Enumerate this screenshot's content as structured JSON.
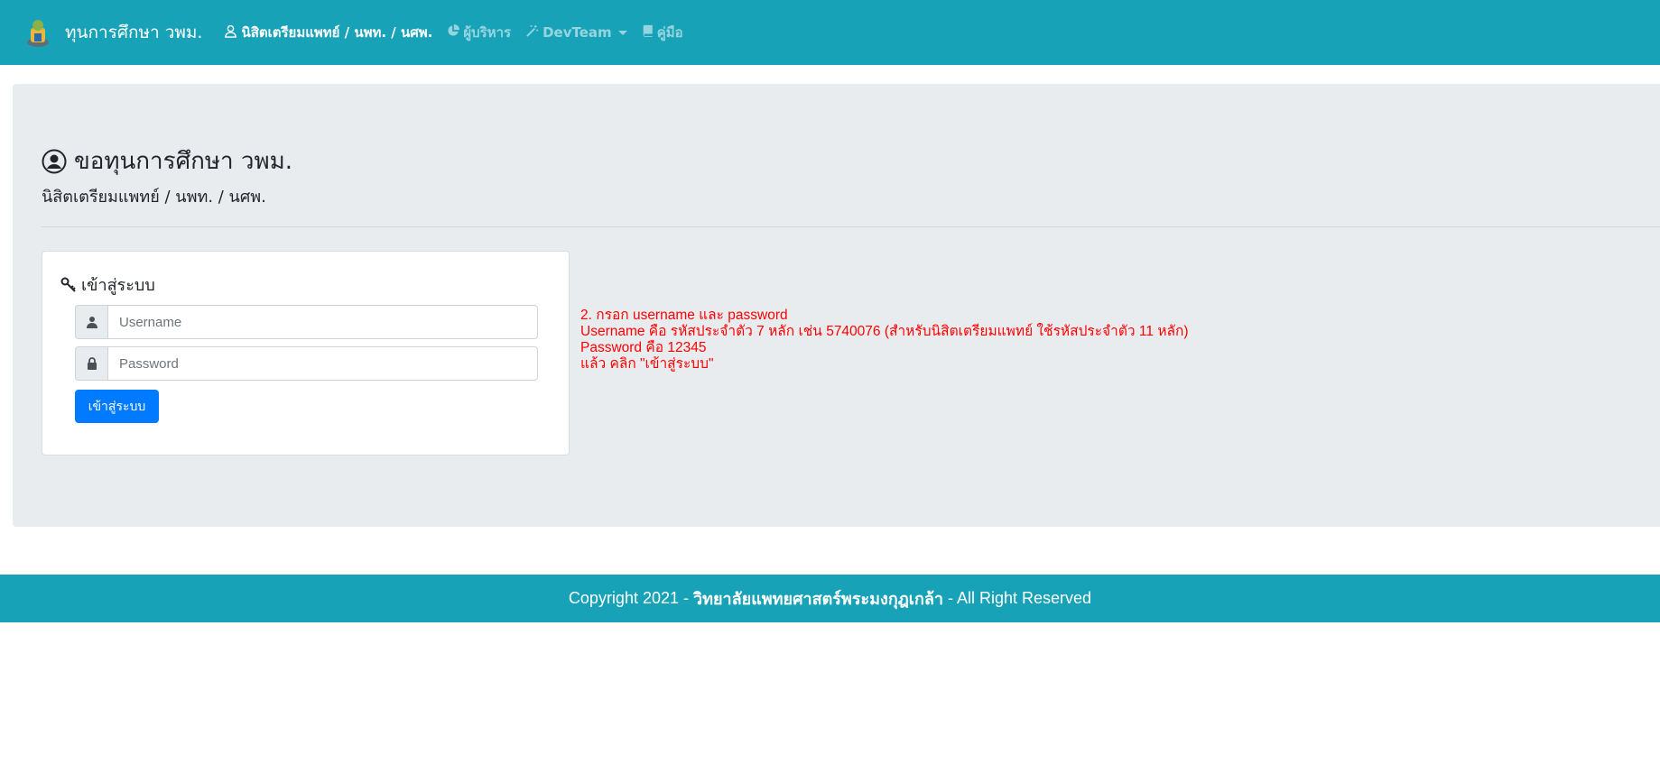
{
  "navbar": {
    "brand_title": "ทุนการศึกษา วพม.",
    "items": [
      {
        "label": "นิสิตเตรียมแพทย์ / นพท. / นศพ.",
        "icon": "user-icon"
      },
      {
        "label": "ผู้บริหาร",
        "icon": "pie-chart-icon"
      },
      {
        "label": "DevTeam",
        "icon": "magic-wand-icon"
      },
      {
        "label": "คู่มือ",
        "icon": "book-icon"
      }
    ]
  },
  "header": {
    "title": "ขอทุนการศึกษา วพม.",
    "subtitle": "นิสิตเตรียมแพทย์ / นพท. / นศพ."
  },
  "login": {
    "title": "เข้าสู่ระบบ",
    "username_placeholder": "Username",
    "password_placeholder": "Password",
    "submit_label": "เข้าสู่ระบบ"
  },
  "instructions": [
    "2. กรอก username และ password",
    "Username คือ รหัสประจำตัว 7 หลัก เช่น 5740076 (สำหรับนิสิตเตรียมแพทย์ ใช้รหัสประจำตัว 11 หลัก)",
    "Password คือ 12345",
    "แล้ว คลิก \"เข้าสู่ระบบ\""
  ],
  "footer": {
    "prefix": "Copyright 2021 - ",
    "org": "วิทยาลัยแพทยศาสตร์พระมงกุฎเกล้า",
    "suffix": " - All Right Reserved"
  },
  "colors": {
    "navbar": "#17a2b8",
    "jumbotron": "#e9ecef",
    "primary_button": "#007bff",
    "instruction_text": "#ff0000"
  }
}
